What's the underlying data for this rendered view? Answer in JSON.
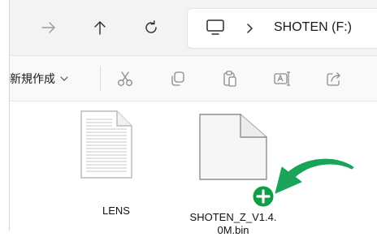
{
  "address": {
    "label": "SHOTEN (F:)",
    "pc_icon": "monitor-icon",
    "separator": "›"
  },
  "nav": {
    "forward_icon": "arrow-right-icon",
    "up_icon": "arrow-up-icon",
    "refresh_icon": "refresh-icon"
  },
  "commandbar": {
    "new_label": "新規作成",
    "icons": [
      "cut-icon",
      "copy-icon",
      "paste-icon",
      "rename-icon",
      "share-icon"
    ]
  },
  "files": [
    {
      "name": "LENS",
      "icon": "text-file-icon"
    },
    {
      "name_line1": "SHOTEN_Z_V1.4.",
      "name_line2": "0M.bin",
      "icon": "blank-file-icon",
      "badge": "add-copy-icon"
    }
  ],
  "colors": {
    "accent_green": "#1aa45a",
    "badge_green": "#0f9d45",
    "icon_gray": "#7a7a7a"
  }
}
